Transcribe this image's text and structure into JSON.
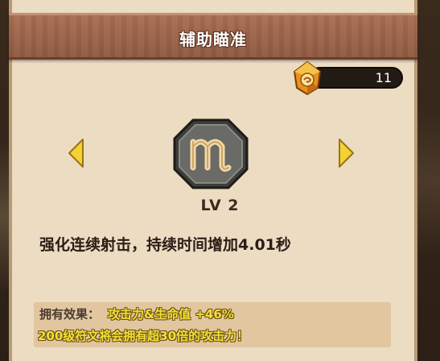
{
  "header": {
    "title": "辅助瞄准"
  },
  "currency": {
    "icon": "crystal-gem-icon",
    "value": "11"
  },
  "rune": {
    "icon": "rune-symbol-icon",
    "glyph": "m",
    "level": "LV 2"
  },
  "navigation": {
    "prev_icon": "left-arrow-icon",
    "next_icon": "right-arrow-icon"
  },
  "skill": {
    "description": "强化连续射击，持续时间增加4.01秒"
  },
  "effects": {
    "label": "拥有效果：",
    "value": "攻击力&生命值 +46%",
    "note": "200级符文将会拥有超30倍的攻击力！"
  },
  "colors": {
    "header": "#9a6247",
    "panel": "#ecdcc2",
    "highlight_text": "#f3e03a",
    "arrow": "#f5d233"
  }
}
